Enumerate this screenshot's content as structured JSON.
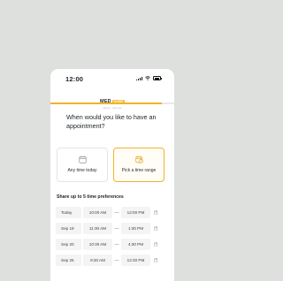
{
  "status_bar": {
    "time": "12:00"
  },
  "brand": {
    "logo_text": "MED",
    "logo_badge": "GUIDE",
    "tagline": "HEALTH · ANYTIME"
  },
  "progress": {
    "value": 0.9
  },
  "question": "When would you like to have an appointment?",
  "options": [
    {
      "label": "Any time today",
      "icon": "calendar-icon",
      "selected": false
    },
    {
      "label": "Pick a time range",
      "icon": "calendar-clock-icon",
      "selected": true
    }
  ],
  "preferences": {
    "title": "Share up to 5 time preferences",
    "separator": "—",
    "rows": [
      {
        "date": "Today",
        "from": "10:00 AM",
        "to": "12:00 PM"
      },
      {
        "date": "Sep 19",
        "from": "11:30 AM",
        "to": "1:30 PM"
      },
      {
        "date": "Sep 20",
        "from": "10:30 AM",
        "to": "4:30 PM"
      },
      {
        "date": "Sep 25",
        "from": "9:30 AM",
        "to": "12:30 PM"
      }
    ]
  },
  "colors": {
    "accent": "#f0b429",
    "background": "#dde0dc"
  }
}
